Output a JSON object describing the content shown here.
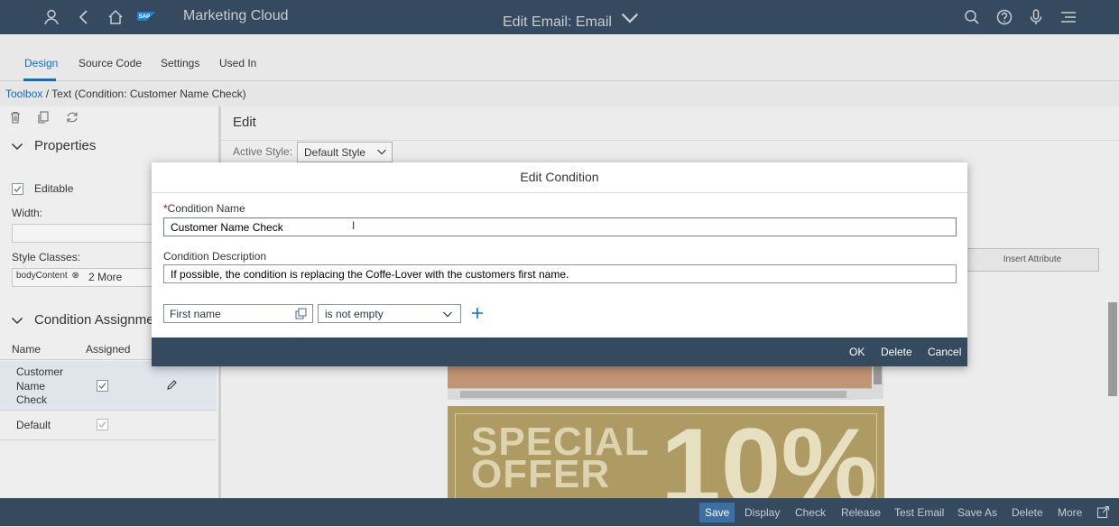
{
  "shell": {
    "logo_text": "SAP",
    "app_name": "Marketing Cloud",
    "title": "Edit Email: Email",
    "icons": [
      "user-icon",
      "back-icon",
      "home-icon",
      "search-icon",
      "help-icon",
      "microphone-icon",
      "menu-icon"
    ]
  },
  "tabs": [
    {
      "label": "Design",
      "active": true
    },
    {
      "label": "Source Code",
      "active": false
    },
    {
      "label": "Settings",
      "active": false
    },
    {
      "label": "Used In",
      "active": false
    }
  ],
  "breadcrumb": {
    "link": "Toolbox",
    "separator": " / ",
    "current": "Text (Condition: Customer Name Check)"
  },
  "left_panel": {
    "toolbar_icons": [
      "trash-icon",
      "copy-icon",
      "refresh-icon"
    ],
    "properties": {
      "title": "Properties",
      "editable_label": "Editable",
      "width_label": "Width:",
      "style_classes_label": "Style Classes:",
      "style_token": "bodyContent",
      "more_label": "2 More"
    },
    "condition_assignment": {
      "title": "Condition Assignment",
      "col_name": "Name",
      "col_assigned": "Assigned",
      "rows": [
        {
          "name": "Customer Name Check",
          "assigned": true
        },
        {
          "name": "Default",
          "assigned": true
        }
      ]
    }
  },
  "edit_area": {
    "title": "Edit",
    "active_style_label": "Active Style:",
    "active_style_value": "Default Style",
    "insert_attribute_label": "Insert Attribute",
    "promo_text_1": "SPECIAL",
    "promo_text_2": "OFFER",
    "promo_percent": "10%"
  },
  "dialog": {
    "title": "Edit Condition",
    "name_label": "Condition Name",
    "name_value": "Customer Name Check",
    "desc_label": "Condition Description",
    "desc_value": "If possible, the condition is replacing the Coffe-Lover with the customers first name.",
    "attribute_value": "First name",
    "operator_value": "is not empty",
    "buttons": {
      "ok": "OK",
      "delete": "Delete",
      "cancel": "Cancel"
    }
  },
  "footer": {
    "buttons": [
      "Save",
      "Display",
      "Check",
      "Release",
      "Test Email",
      "Save As",
      "Delete",
      "More"
    ]
  },
  "colors": {
    "shell": "#354a5f",
    "accent": "#0a6ed1",
    "promo": "#ae9b64"
  }
}
